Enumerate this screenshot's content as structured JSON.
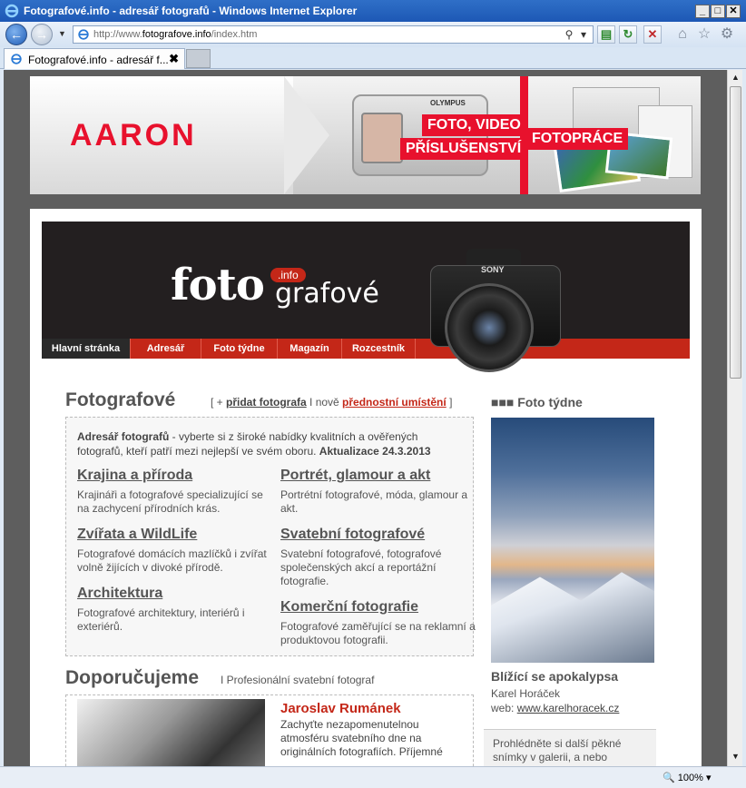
{
  "window": {
    "title": "Fotografové.info - adresář fotografů - Windows Internet Explorer",
    "controls": [
      "_",
      "□",
      "✕"
    ]
  },
  "address": {
    "url_prefix": "http://www.",
    "url_domain": "fotografove.info",
    "url_path": "/index.htm"
  },
  "tab": {
    "label": "Fotografové.info - adresář f...",
    "close": "✖"
  },
  "status": {
    "zoom": "100%"
  },
  "banner": {
    "brand": "AARON",
    "camera_brand": "OLYMPUS",
    "tag1": "FOTO, VIDEO",
    "tag2": "PŘÍSLUŠENSTVÍ",
    "tag3": "FOTOPRÁCE"
  },
  "header": {
    "logo_foto": "foto",
    "logo_grafove": "grafové",
    "logo_info": ".info",
    "camera_brand": "SONY",
    "nav": [
      "Hlavní stránka",
      "Adresář",
      "Foto týdne",
      "Magazín",
      "Rozcestník"
    ]
  },
  "main": {
    "title": "Fotografové",
    "links_open": "[ + ",
    "add_link": "přidat fotografa",
    "links_sep": " I nově ",
    "featured_link": "přednostní umístění",
    "links_close": " ]",
    "intro_bold": "Adresář fotografů",
    "intro_text": " - vyberte si z široké nabídky kvalitních a ověřených fotografů, kteří patří mezi nejlepší ve svém oboru. ",
    "intro_update": "Aktualizace 24.3.2013",
    "categories": [
      {
        "title": "Krajina a příroda",
        "desc": "Krajináři a fotografové specializující se na zachycení přírodních krás."
      },
      {
        "title": "Portrét, glamour a akt",
        "desc": "Portrétní fotografové, móda, glamour a akt."
      },
      {
        "title": "Zvířata a WildLife",
        "desc": "Fotografové domácích mazlíčků i zvířat volně žijících v divoké přírodě."
      },
      {
        "title": "Svatební fotografové",
        "desc": "Svatební fotografové, fotografové společenských akcí a reportážní fotografie."
      },
      {
        "title": "Architektura",
        "desc": "Fotografové architektury, interiérů i exteriérů."
      },
      {
        "title": "Komerční fotografie",
        "desc": "Fotografové zaměřující se na reklamní a produktovou fotografii."
      }
    ]
  },
  "recommend": {
    "title": "Doporučujeme",
    "subtitle": "I Profesionální svatební fotograf",
    "name": "Jaroslav Rumánek",
    "text": "Zachyťte nezapomenutelnou atmosféru svatebního dne na originálních fotografiích. Příjemné"
  },
  "side": {
    "title": "■■■ Foto týdne",
    "caption": "Blížící se apokalypsa",
    "author": "Karel Horáček",
    "web_label": "web: ",
    "web_link": "www.karelhoracek.cz",
    "more_text": "Prohlédněte si další pěkné snímky v galerii, a nebo"
  },
  "colors": {
    "accent": "#c42718",
    "brand_red": "#e8112d",
    "header_bg": "#231f20"
  }
}
